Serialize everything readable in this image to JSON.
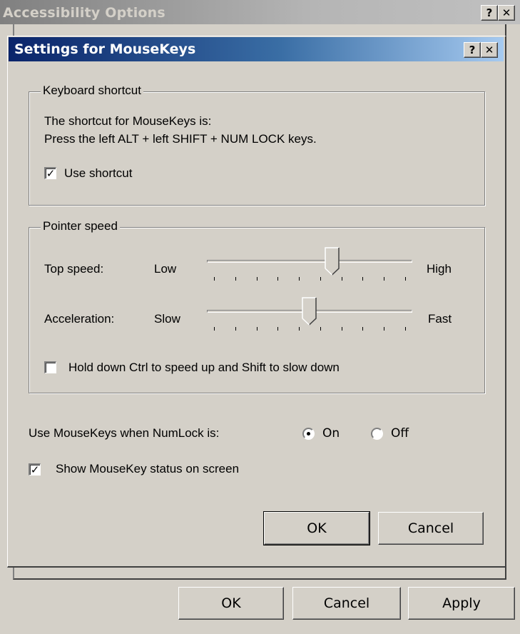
{
  "parent_window": {
    "title": "Accessibility Options",
    "help_glyph": "?",
    "close_glyph": "✕",
    "buttons": {
      "ok": "OK",
      "cancel": "Cancel",
      "apply": "Apply"
    }
  },
  "dialog": {
    "title": "Settings for MouseKeys",
    "help_glyph": "?",
    "close_glyph": "✕",
    "keyboard_shortcut": {
      "legend": "Keyboard shortcut",
      "line1": "The shortcut for MouseKeys is:",
      "line2": "Press the left ALT + left SHIFT + NUM LOCK keys.",
      "use_shortcut_label": "Use shortcut",
      "use_shortcut_checked": true
    },
    "pointer_speed": {
      "legend": "Pointer speed",
      "top_speed": {
        "label": "Top speed:",
        "min_label": "Low",
        "max_label": "High",
        "position": 0.62
      },
      "acceleration": {
        "label": "Acceleration:",
        "min_label": "Slow",
        "max_label": "Fast",
        "position": 0.5
      },
      "ctrl_shift_label": "Hold down Ctrl to speed up and Shift to slow down",
      "ctrl_shift_checked": false
    },
    "numlock": {
      "label": "Use MouseKeys when NumLock is:",
      "on_label": "On",
      "off_label": "Off",
      "selected": "On"
    },
    "status": {
      "label": "Show MouseKey status on screen",
      "checked": true
    },
    "buttons": {
      "ok": "OK",
      "cancel": "Cancel"
    }
  },
  "colors": {
    "face": "#d4d0c8",
    "active_title_start": "#0a246a",
    "active_title_end": "#a6caf0",
    "inactive_title": "#808080"
  }
}
